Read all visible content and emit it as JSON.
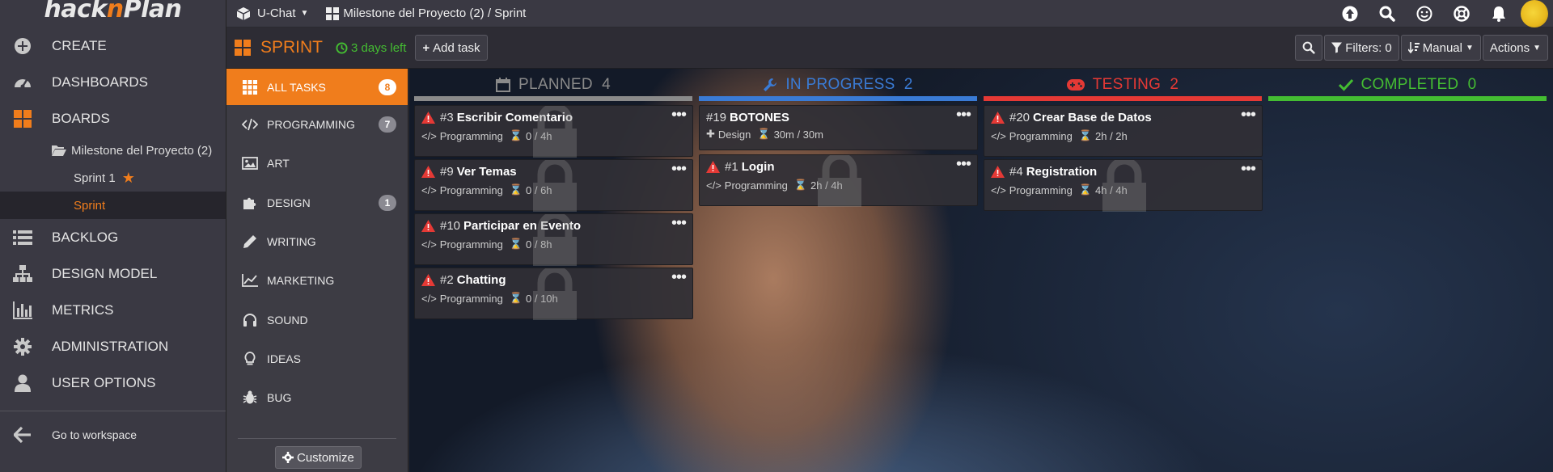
{
  "logo": {
    "part1": "hack",
    "part2": "n",
    "part3": "Plan"
  },
  "nav": {
    "create": "CREATE",
    "dashboards": "DASHBOARDS",
    "boards": "BOARDS",
    "milestone": "Milestone del Proyecto (2)",
    "sprint1": "Sprint 1",
    "sprint": "Sprint",
    "backlog": "BACKLOG",
    "design_model": "DESIGN MODEL",
    "metrics": "METRICS",
    "administration": "ADMINISTRATION",
    "user_options": "USER OPTIONS",
    "go_workspace": "Go to workspace"
  },
  "topbar": {
    "project": "U-Chat",
    "breadcrumb": "Milestone del Proyecto (2) / Sprint"
  },
  "sprintbar": {
    "title": "SPRINT",
    "days_left": "3 days left",
    "add_task": "Add task",
    "filters": "Filters: 0",
    "sort": "Manual",
    "actions": "Actions"
  },
  "categories": {
    "all": {
      "label": "ALL TASKS",
      "count": "8"
    },
    "programming": {
      "label": "PROGRAMMING",
      "count": "7"
    },
    "art": {
      "label": "ART"
    },
    "design": {
      "label": "DESIGN",
      "count": "1"
    },
    "writing": {
      "label": "WRITING"
    },
    "marketing": {
      "label": "MARKETING"
    },
    "sound": {
      "label": "SOUND"
    },
    "ideas": {
      "label": "IDEAS"
    },
    "bug": {
      "label": "BUG"
    },
    "customize": "Customize"
  },
  "columns": {
    "planned": {
      "label": "PLANNED",
      "count": "4",
      "color": "#8a8a8a"
    },
    "in_progress": {
      "label": "IN PROGRESS",
      "count": "2",
      "color": "#3a7bd5"
    },
    "testing": {
      "label": "TESTING",
      "count": "2",
      "color": "#e53935"
    },
    "completed": {
      "label": "COMPLETED",
      "count": "0",
      "color": "#44bd32"
    }
  },
  "cards": {
    "c3": {
      "num": "#3",
      "title": "Escribir Comentario",
      "category": "Programming",
      "time": "0 / 4h"
    },
    "c9": {
      "num": "#9",
      "title": "Ver Temas",
      "category": "Programming",
      "time": "0 / 6h"
    },
    "c10": {
      "num": "#10",
      "title": "Participar en Evento",
      "category": "Programming",
      "time": "0 / 8h"
    },
    "c2": {
      "num": "#2",
      "title": "Chatting",
      "category": "Programming",
      "time": "0 / 10h"
    },
    "c19": {
      "num": "#19",
      "title": "BOTONES",
      "category": "Design",
      "time": "30m / 30m"
    },
    "c1": {
      "num": "#1",
      "title": "Login",
      "category": "Programming",
      "time": "2h / 4h"
    },
    "c20": {
      "num": "#20",
      "title": "Crear Base de Datos",
      "category": "Programming",
      "time": "2h / 2h"
    },
    "c4": {
      "num": "#4",
      "title": "Registration",
      "category": "Programming",
      "time": "4h / 4h"
    }
  },
  "colors": {
    "accent": "#f07d1c",
    "success": "#44bd32",
    "danger": "#e53935",
    "info": "#3a7bd5"
  }
}
